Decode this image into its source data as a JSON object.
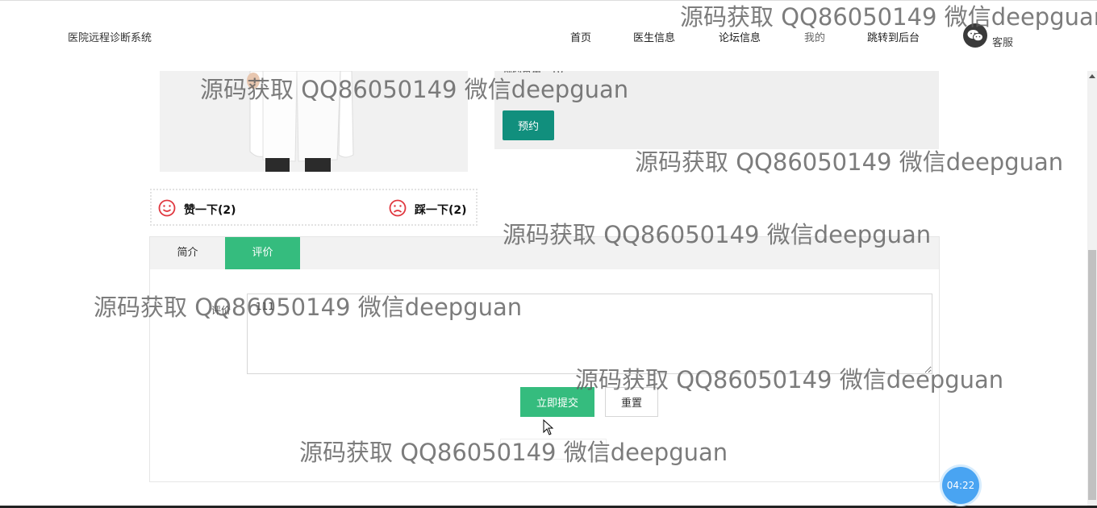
{
  "header": {
    "site_title": "医院远程诊断系统",
    "nav": [
      "首页",
      "医生信息",
      "论坛信息",
      "我的",
      "跳转到后台"
    ],
    "kefu_label": "客服"
  },
  "doctor": {
    "fee_text": "预约费用：10",
    "book_label": "预约"
  },
  "votes": {
    "like_label": "赞一下(2)",
    "dislike_label": "踩一下(2)"
  },
  "tabs": {
    "intro_label": "简介",
    "review_label": "评价"
  },
  "review_form": {
    "field_label": "评价",
    "value": "111",
    "submit_label": "立即提交",
    "reset_label": "重置"
  },
  "watermark_text": "源码获取 QQ86050149 微信deepguan",
  "timer": "04:22",
  "colors": {
    "primary_green": "#35bc7e",
    "book_teal": "#118f7d",
    "timer_blue": "#49a4f2",
    "smiley_red": "#e0373f"
  }
}
